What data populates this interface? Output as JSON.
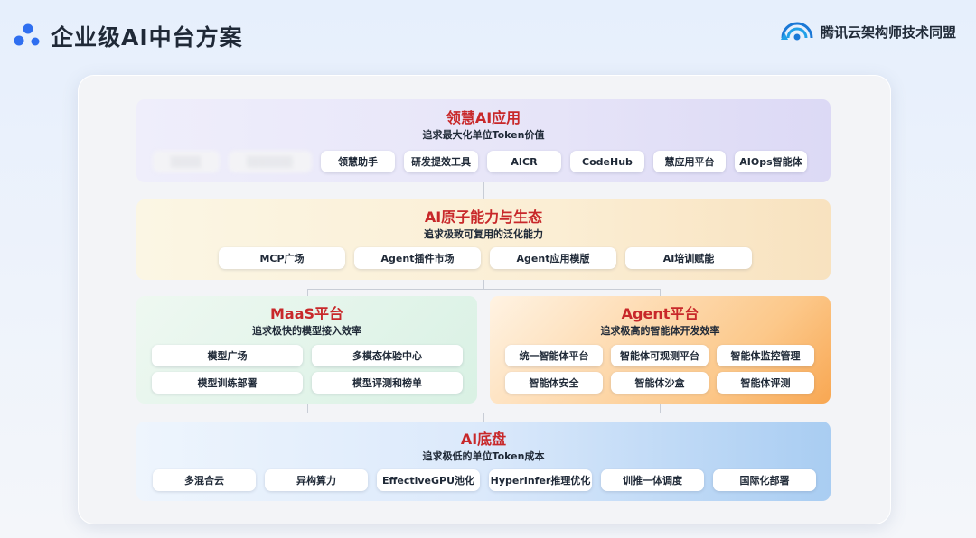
{
  "header": {
    "title": "企业级AI中台方案",
    "brand": "腾讯云架构师技术同盟",
    "logo_icon": "dots-logo-icon",
    "brand_icon": "wifi-cloud-icon"
  },
  "colors": {
    "accent_red": "#c8282a",
    "text_dark": "#1f2937"
  },
  "layers": {
    "apps": {
      "title": "领慧AI应用",
      "subtitle": "追求最大化单位Token价值",
      "items": [
        "领慧助手",
        "研发提效工具",
        "AICR",
        "CodeHub",
        "慧应用平台",
        "AIOps智能体"
      ]
    },
    "ecosystem": {
      "title": "AI原子能力与生态",
      "subtitle": "追求极致可复用的泛化能力",
      "items": [
        "MCP广场",
        "Agent插件市场",
        "Agent应用模版",
        "AI培训赋能"
      ]
    },
    "maas": {
      "title": "MaaS平台",
      "subtitle": "追求极快的模型接入效率",
      "items": [
        "模型广场",
        "多模态体验中心",
        "模型训练部署",
        "模型评测和榜单"
      ]
    },
    "agent": {
      "title": "Agent平台",
      "subtitle": "追求极高的智能体开发效率",
      "items": [
        "统一智能体平台",
        "智能体可观测平台",
        "智能体监控管理",
        "智能体安全",
        "智能体沙盒",
        "智能体评测"
      ]
    },
    "base": {
      "title": "AI底盘",
      "subtitle": "追求极低的单位Token成本",
      "items": [
        "多混合云",
        "异构算力",
        "EffectiveGPU池化",
        "HyperInfer推理优化",
        "训推一体调度",
        "国际化部署"
      ]
    }
  }
}
